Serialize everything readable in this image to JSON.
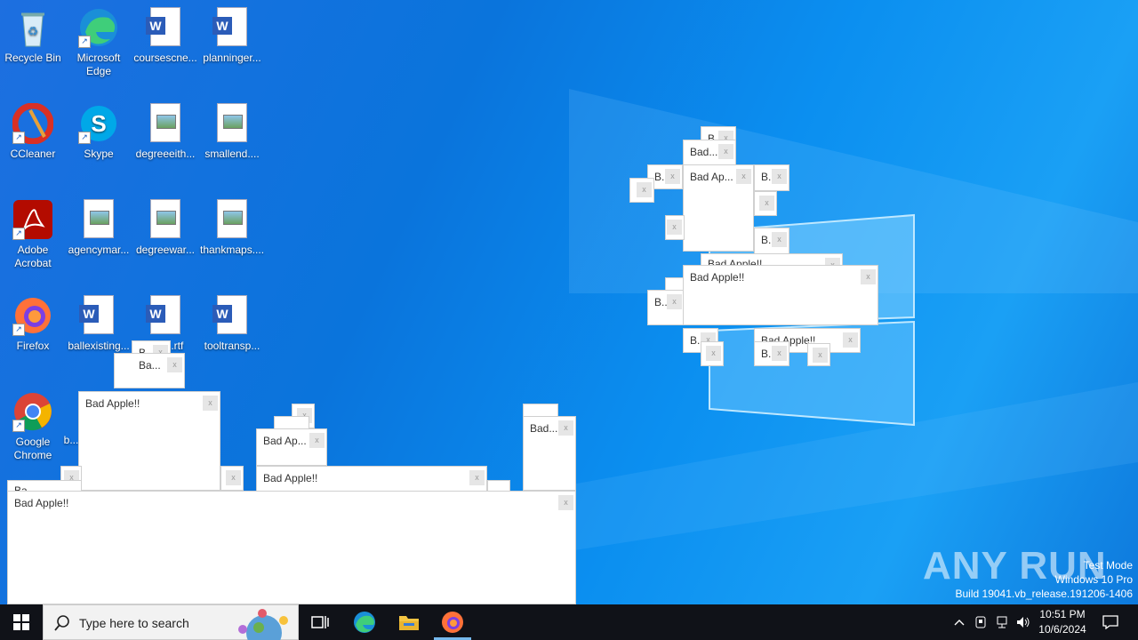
{
  "desktop_icons": [
    {
      "label": "Recycle Bin",
      "icon": "recycle-bin-icon"
    },
    {
      "label": "Microsoft Edge",
      "icon": "edge-icon"
    },
    {
      "label": "coursescne...",
      "icon": "word-doc-icon"
    },
    {
      "label": "planninger...",
      "icon": "word-doc-icon"
    },
    {
      "label": "CCleaner",
      "icon": "ccleaner-icon"
    },
    {
      "label": "Skype",
      "icon": "skype-icon"
    },
    {
      "label": "degreeeith...",
      "icon": "image-file-icon"
    },
    {
      "label": "smallend....",
      "icon": "image-file-icon"
    },
    {
      "label": "Adobe Acrobat",
      "icon": "acrobat-icon"
    },
    {
      "label": "agencymar...",
      "icon": "image-file-icon"
    },
    {
      "label": "degreewar...",
      "icon": "image-file-icon"
    },
    {
      "label": "thankmaps....",
      "icon": "image-file-icon"
    },
    {
      "label": "Firefox",
      "icon": "firefox-icon"
    },
    {
      "label": "ballexisting...",
      "icon": "word-doc-icon"
    },
    {
      "label": "...rtf",
      "icon": "word-doc-icon"
    },
    {
      "label": "tooltransp...",
      "icon": "word-doc-icon"
    },
    {
      "label": "Google Chrome",
      "icon": "chrome-icon"
    },
    {
      "label": "b...",
      "icon": "word-doc-icon"
    }
  ],
  "popups": {
    "full": "Bad Apple!!",
    "short1": "Bad Ap...",
    "short2": "Bad...",
    "short3": "B...",
    "short4": "Bad Ap...",
    "frag": "Ba...",
    "frag2": "Bad Apple!!",
    "close": "x"
  },
  "watermark": {
    "line1": "Test Mode",
    "line2": "Windows 10 Pro",
    "line3": "Build 19041.vb_release.191206-1406",
    "brand": "ANY RUN"
  },
  "taskbar": {
    "search_placeholder": "Type here to search",
    "time": "10:51 PM",
    "date": "10/6/2024"
  }
}
